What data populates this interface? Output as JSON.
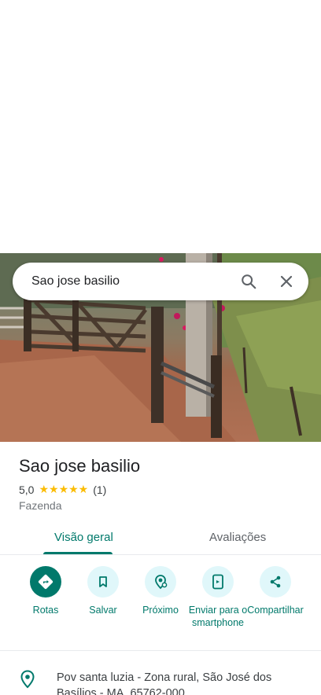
{
  "search": {
    "query": "Sao jose basilio"
  },
  "place": {
    "name": "Sao jose basilio",
    "rating": "5,0",
    "stars": "★★★★★",
    "review_count": "(1)",
    "category": "Fazenda"
  },
  "tabs": [
    {
      "label": "Visão geral"
    },
    {
      "label": "Avaliações"
    }
  ],
  "actions": [
    {
      "label": "Rotas",
      "icon": "directions-icon"
    },
    {
      "label": "Salvar",
      "icon": "bookmark-icon"
    },
    {
      "label": "Próximo",
      "icon": "nearby-icon"
    },
    {
      "label": "Enviar para o smartphone",
      "icon": "send-to-phone-icon"
    },
    {
      "label": "Compartilhar",
      "icon": "share-icon"
    }
  ],
  "address": "Pov santa luzia - Zona rural, São José dos Basílios - MA, 65762-000",
  "colors": {
    "accent": "#00796b",
    "accent_light": "#e0f7fa",
    "star": "#fbbc04"
  }
}
